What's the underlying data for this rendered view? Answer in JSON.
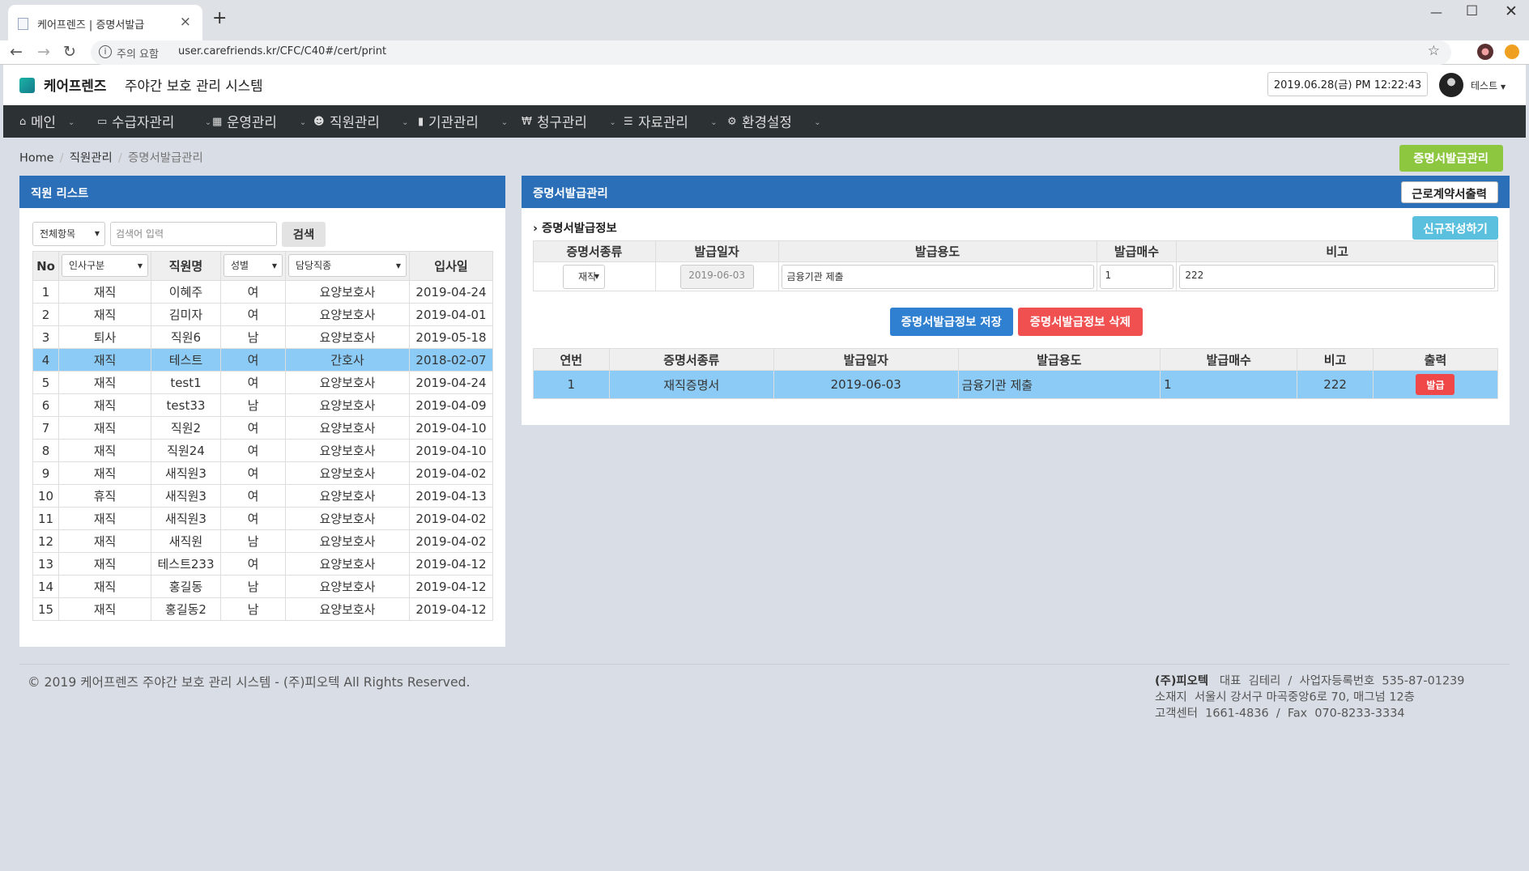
{
  "browser": {
    "tab_title": "케어프렌즈 | 증명서발급",
    "address_warning": "주의 요함",
    "url": "user.carefriends.kr/CFC/C40#/cert/print"
  },
  "header": {
    "brand": "케어프렌즈",
    "system_name": "주야간 보호 관리 시스템",
    "datetime": "2019.06.28(금) PM 12:22:43",
    "user": "테스트"
  },
  "menu": [
    {
      "label": "메인",
      "icon": "home-icon"
    },
    {
      "label": "수급자관리",
      "icon": "id-card-icon"
    },
    {
      "label": "운영관리",
      "icon": "calendar-icon"
    },
    {
      "label": "직원관리",
      "icon": "users-icon"
    },
    {
      "label": "기관관리",
      "icon": "building-icon"
    },
    {
      "label": "청구관리",
      "icon": "won-icon"
    },
    {
      "label": "자료관리",
      "icon": "list-icon"
    },
    {
      "label": "환경설정",
      "icon": "gear-icon"
    }
  ],
  "breadcrumb": [
    "Home",
    "직원관리",
    "증명서발급관리"
  ],
  "top_button": "증명서발급관리",
  "left_panel": {
    "title": "직원 리스트",
    "filter_select": "전체항목",
    "search_placeholder": "검색어 입력",
    "search_button": "검색",
    "columns": {
      "no": "No",
      "type_select": "인사구분",
      "name": "직원명",
      "gender_select": "성별",
      "job_select": "담당직종",
      "hired": "입사일"
    },
    "rows": [
      {
        "no": "1",
        "status": "재직",
        "name": "이혜주",
        "gender": "여",
        "job": "요양보호사",
        "hired": "2019-04-24"
      },
      {
        "no": "2",
        "status": "재직",
        "name": "김미자",
        "gender": "여",
        "job": "요양보호사",
        "hired": "2019-04-01"
      },
      {
        "no": "3",
        "status": "퇴사",
        "name": "직원6",
        "gender": "남",
        "job": "요양보호사",
        "hired": "2019-05-18"
      },
      {
        "no": "4",
        "status": "재직",
        "name": "테스트",
        "gender": "여",
        "job": "간호사",
        "hired": "2018-02-07"
      },
      {
        "no": "5",
        "status": "재직",
        "name": "test1",
        "gender": "여",
        "job": "요양보호사",
        "hired": "2019-04-24"
      },
      {
        "no": "6",
        "status": "재직",
        "name": "test33",
        "gender": "남",
        "job": "요양보호사",
        "hired": "2019-04-09"
      },
      {
        "no": "7",
        "status": "재직",
        "name": "직원2",
        "gender": "여",
        "job": "요양보호사",
        "hired": "2019-04-10"
      },
      {
        "no": "8",
        "status": "재직",
        "name": "직원24",
        "gender": "여",
        "job": "요양보호사",
        "hired": "2019-04-10"
      },
      {
        "no": "9",
        "status": "재직",
        "name": "새직원3",
        "gender": "여",
        "job": "요양보호사",
        "hired": "2019-04-02"
      },
      {
        "no": "10",
        "status": "휴직",
        "name": "새직원3",
        "gender": "여",
        "job": "요양보호사",
        "hired": "2019-04-13"
      },
      {
        "no": "11",
        "status": "재직",
        "name": "새직원3",
        "gender": "여",
        "job": "요양보호사",
        "hired": "2019-04-02"
      },
      {
        "no": "12",
        "status": "재직",
        "name": "새직원",
        "gender": "남",
        "job": "요양보호사",
        "hired": "2019-04-02"
      },
      {
        "no": "13",
        "status": "재직",
        "name": "테스트233",
        "gender": "여",
        "job": "요양보호사",
        "hired": "2019-04-12"
      },
      {
        "no": "14",
        "status": "재직",
        "name": "홍길동",
        "gender": "남",
        "job": "요양보호사",
        "hired": "2019-04-12"
      },
      {
        "no": "15",
        "status": "재직",
        "name": "홍길동2",
        "gender": "남",
        "job": "요양보호사",
        "hired": "2019-04-12"
      }
    ],
    "selected_index": 3
  },
  "right_panel": {
    "title": "증명서발급관리",
    "print_contract_button": "근로계약서출력",
    "section_title": "증명서발급정보",
    "new_button": "신규작성하기",
    "form_columns": [
      "증명서종류",
      "발급일자",
      "발급용도",
      "발급매수",
      "비고"
    ],
    "form": {
      "cert_type": "재직",
      "issue_date": "2019-06-03",
      "purpose": "금융기관 제출",
      "copies": "1",
      "note": "222"
    },
    "save_button": "증명서발급정보 저장",
    "delete_button": "증명서발급정보 삭제",
    "history_columns": [
      "연번",
      "증명서종류",
      "발급일자",
      "발급용도",
      "발급매수",
      "비고",
      "출력"
    ],
    "history": [
      {
        "seq": "1",
        "cert_type": "재직증명서",
        "date": "2019-06-03",
        "purpose": "금융기관 제출",
        "copies": "1",
        "note": "222",
        "action": "발급"
      }
    ]
  },
  "footer": {
    "copyright": "© 2019 케어프렌즈 주야간 보호 관리 시스템 - (주)피오텍 All Rights Reserved.",
    "company": "(주)피오텍",
    "ceo_label": "대표",
    "ceo": "김테리",
    "biz_label": "사업자등록번호",
    "biz_no": "535-87-01239",
    "addr_label": "소재지",
    "address": "서울시 강서구 마곡중앙6로 70, 매그넘 12층",
    "cs_label": "고객센터",
    "cs_phone": "1661-4836",
    "fax_label": "Fax",
    "fax": "070-8233-3334"
  }
}
